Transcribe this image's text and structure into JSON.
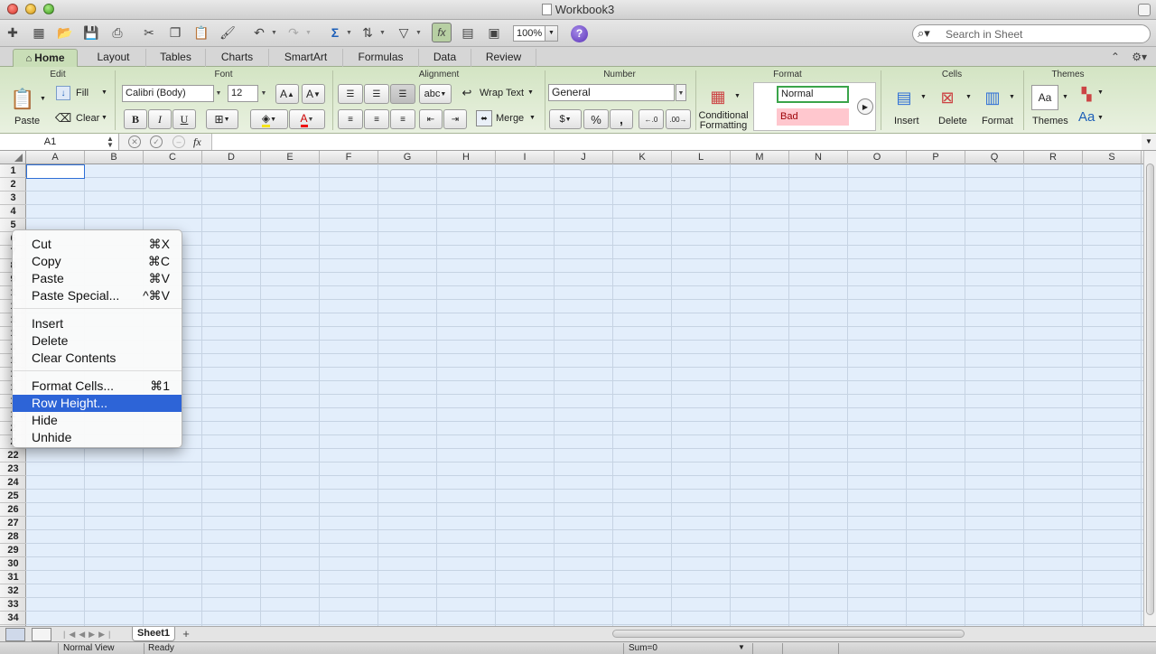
{
  "window": {
    "title": "Workbook3"
  },
  "toolbar": {
    "zoom": "100%",
    "search_placeholder": "Search in Sheet"
  },
  "ribbon_tabs": [
    "Home",
    "Layout",
    "Tables",
    "Charts",
    "SmartArt",
    "Formulas",
    "Data",
    "Review"
  ],
  "ribbon": {
    "groups": {
      "edit": "Edit",
      "font": "Font",
      "alignment": "Alignment",
      "number": "Number",
      "format": "Format",
      "cells": "Cells",
      "themes": "Themes"
    },
    "edit": {
      "paste": "Paste",
      "fill": "Fill",
      "clear": "Clear"
    },
    "font": {
      "name": "Calibri (Body)",
      "size": "12",
      "bold": "B",
      "italic": "I",
      "underline": "U"
    },
    "alignment": {
      "orientation": "abc",
      "wrap_text": "Wrap Text",
      "merge": "Merge"
    },
    "number": {
      "format": "General",
      "percent": "%",
      "comma": ","
    },
    "format": {
      "conditional_line1": "Conditional",
      "conditional_line2": "Formatting",
      "style_normal": "Normal",
      "style_bad": "Bad"
    },
    "cells": {
      "insert": "Insert",
      "delete": "Delete",
      "format": "Format"
    },
    "themes": {
      "themes": "Themes",
      "fonts": "Aa"
    }
  },
  "formula_bar": {
    "name_box": "A1",
    "fx": "fx",
    "value": ""
  },
  "grid": {
    "columns": [
      "A",
      "B",
      "C",
      "D",
      "E",
      "F",
      "G",
      "H",
      "I",
      "J",
      "K",
      "L",
      "M",
      "N",
      "O",
      "P",
      "Q",
      "R",
      "S"
    ],
    "rows": [
      "1",
      "2",
      "3",
      "4",
      "5",
      "6",
      "7",
      "8",
      "9",
      "1",
      "1",
      "1",
      "1",
      "1",
      "1",
      "1",
      "1",
      "1",
      "1",
      "2",
      "2",
      "22",
      "23",
      "24",
      "25",
      "26",
      "27",
      "28",
      "29",
      "30",
      "31",
      "32",
      "33",
      "34"
    ]
  },
  "context_menu": {
    "items": [
      {
        "label": "Cut",
        "shortcut": "⌘X"
      },
      {
        "label": "Copy",
        "shortcut": "⌘C"
      },
      {
        "label": "Paste",
        "shortcut": "⌘V"
      },
      {
        "label": "Paste Special...",
        "shortcut": "^⌘V"
      },
      {
        "label": "Insert",
        "shortcut": ""
      },
      {
        "label": "Delete",
        "shortcut": ""
      },
      {
        "label": "Clear Contents",
        "shortcut": ""
      },
      {
        "label": "Format Cells...",
        "shortcut": "⌘1"
      },
      {
        "label": "Row Height...",
        "shortcut": ""
      },
      {
        "label": "Hide",
        "shortcut": ""
      },
      {
        "label": "Unhide",
        "shortcut": ""
      }
    ],
    "highlighted": "Row Height..."
  },
  "sheets": {
    "tabs": [
      "Sheet1"
    ],
    "add": "+"
  },
  "status_bar": {
    "view": "Normal View",
    "state": "Ready",
    "sum": "Sum=0"
  },
  "colors": {
    "ribbon_green": "#d3e4c3",
    "selection_blue": "#2d64d7",
    "cell_tint": "#e3eefb",
    "bad_fill": "#ffc7ce",
    "normal_border": "#3aa44a"
  }
}
